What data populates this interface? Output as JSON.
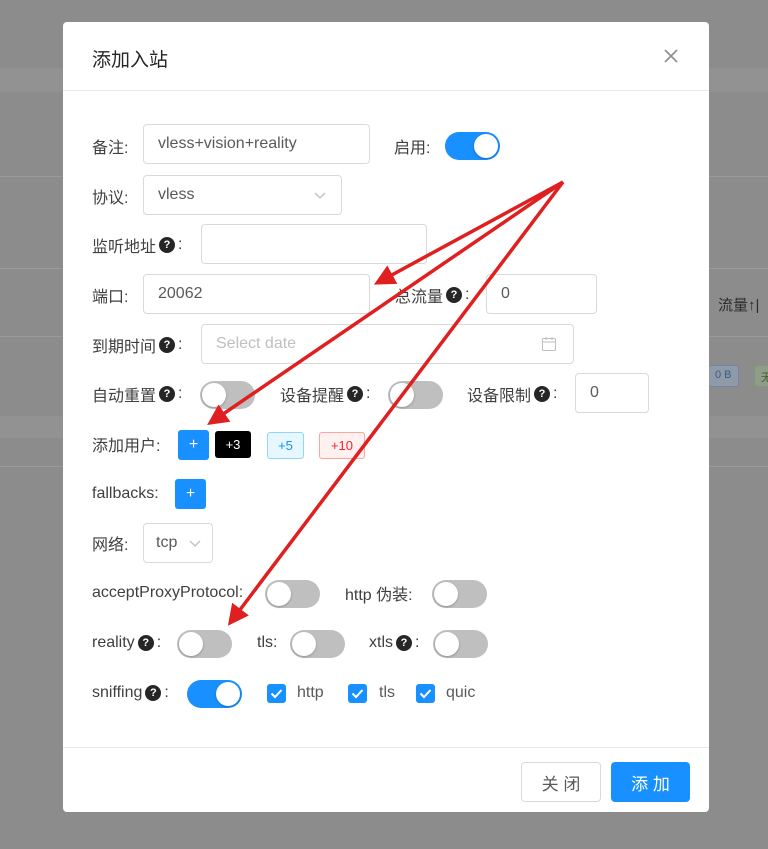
{
  "background": {
    "column_header": "流量↑|",
    "tag_1": "0 B",
    "tag_2": "无"
  },
  "modal": {
    "title": "添加入站",
    "close_icon": "close-icon",
    "fields": {
      "remark_label": "备注:",
      "remark_value": "vless+vision+reality",
      "enable_label": "启用:",
      "enable_on": true,
      "protocol_label": "协议:",
      "protocol_value": "vless",
      "listen_label": "监听地址",
      "listen_value": "",
      "port_label": "端口:",
      "port_value": "20062",
      "total_label": "总流量",
      "total_value": "0",
      "expiry_label": "到期时间",
      "expiry_placeholder": "Select date",
      "auto_reset_label": "自动重置",
      "auto_reset_on": false,
      "device_alert_label": "设备提醒",
      "device_alert_on": false,
      "device_limit_label": "设备限制",
      "device_limit_value": "0",
      "add_user_label": "添加用户:",
      "add_user_plus": "+",
      "add_user_tags": [
        "+3",
        "+5",
        "+10"
      ],
      "fallbacks_label": "fallbacks:",
      "fallbacks_plus": "+",
      "network_label": "网络:",
      "network_value": "tcp",
      "accept_proxy_label": "acceptProxyProtocol:",
      "accept_proxy_on": false,
      "http_camouflage_label": "http 伪装:",
      "http_camouflage_on": false,
      "reality_label": "reality",
      "reality_on": false,
      "tls_label": "tls:",
      "tls_on": false,
      "xtls_label": "xtls",
      "xtls_on": false,
      "sniffing_label": "sniffing",
      "sniffing_on": true,
      "sniff_options": [
        "http",
        "tls",
        "quic"
      ],
      "sniff_checked": [
        true,
        true,
        true
      ]
    },
    "footer": {
      "close_label": "关 闭",
      "add_label": "添 加"
    }
  },
  "annotation": {
    "arrow_color": "#e02020"
  },
  "colors": {
    "primary": "#1890ff",
    "switch_off": "#bfbfbf",
    "overlay": "#8c8c8c"
  }
}
